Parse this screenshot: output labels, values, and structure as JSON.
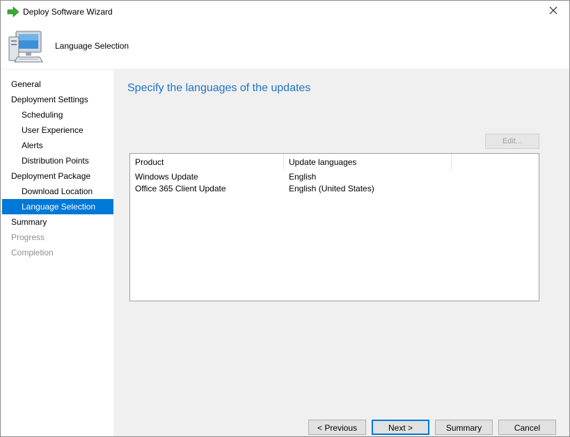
{
  "window": {
    "title": "Deploy Software Wizard"
  },
  "header": {
    "title": "Language Selection"
  },
  "sidebar": {
    "items": [
      {
        "label": "General",
        "level": 0,
        "state": "normal"
      },
      {
        "label": "Deployment Settings",
        "level": 0,
        "state": "normal"
      },
      {
        "label": "Scheduling",
        "level": 1,
        "state": "normal"
      },
      {
        "label": "User Experience",
        "level": 1,
        "state": "normal"
      },
      {
        "label": "Alerts",
        "level": 1,
        "state": "normal"
      },
      {
        "label": "Distribution Points",
        "level": 1,
        "state": "normal"
      },
      {
        "label": "Deployment Package",
        "level": 0,
        "state": "normal"
      },
      {
        "label": "Download Location",
        "level": 1,
        "state": "normal"
      },
      {
        "label": "Language Selection",
        "level": 1,
        "state": "active"
      },
      {
        "label": "Summary",
        "level": 0,
        "state": "normal"
      },
      {
        "label": "Progress",
        "level": 0,
        "state": "disabled"
      },
      {
        "label": "Completion",
        "level": 0,
        "state": "disabled"
      }
    ]
  },
  "main": {
    "title": "Specify the languages of the updates",
    "edit_label": "Edit...",
    "table": {
      "columns": [
        "Product",
        "Update languages"
      ],
      "rows": [
        [
          "Windows Update",
          "English"
        ],
        [
          "Office 365 Client Update",
          "English (United States)"
        ]
      ]
    }
  },
  "footer": {
    "previous_label": "< Previous",
    "next_label": "Next >",
    "summary_label": "Summary",
    "cancel_label": "Cancel"
  },
  "colors": {
    "accent": "#0078d7",
    "title_blue": "#1f73c6",
    "content_bg": "#f0f0f0",
    "icon_green": "#3aaa35"
  },
  "icons": {
    "title": "green-arrow-icon",
    "header": "computer-icon",
    "close": "close-icon"
  }
}
